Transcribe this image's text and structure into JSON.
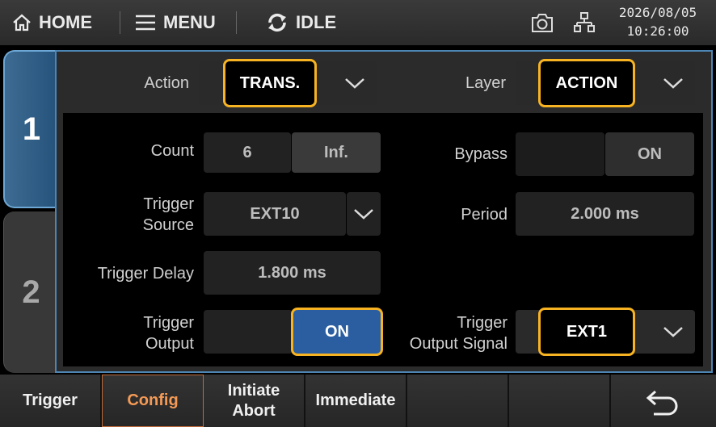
{
  "topbar": {
    "home_label": "HOME",
    "menu_label": "MENU",
    "status_label": "IDLE",
    "date": "2026/08/05",
    "time": "10:26:00"
  },
  "channels": [
    "1",
    "2"
  ],
  "config": {
    "action_label": "Action",
    "action_value": "TRANS.",
    "layer_label": "Layer",
    "layer_value": "ACTION",
    "count_label": "Count",
    "count_value": "6",
    "count_inf": "Inf.",
    "bypass_label": "Bypass",
    "bypass_value": "ON",
    "trigger_source_label_1": "Trigger",
    "trigger_source_label_2": "Source",
    "trigger_source_value": "EXT10",
    "period_label": "Period",
    "period_value": "2.000 ms",
    "trigger_delay_label": "Trigger Delay",
    "trigger_delay_value": "1.800 ms",
    "trigger_output_label_1": "Trigger",
    "trigger_output_label_2": "Output",
    "trigger_output_value": "ON",
    "trigger_output_signal_label_1": "Trigger",
    "trigger_output_signal_label_2": "Output Signal",
    "trigger_output_signal_value": "EXT1"
  },
  "softkeys": {
    "trigger": "Trigger",
    "config": "Config",
    "initiate": "Initiate",
    "abort": "Abort",
    "immediate": "Immediate"
  },
  "colors": {
    "highlight": "#f7b322",
    "on_blue": "#2a5ea0",
    "active_softkey": "#f49a55",
    "tab_blue": "#4d86b5"
  }
}
